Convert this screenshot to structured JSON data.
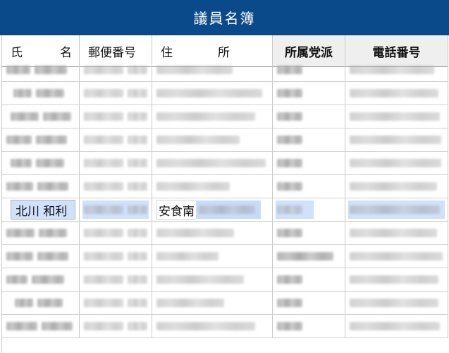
{
  "title": "議員名簿",
  "columns": {
    "name_a": "氏",
    "name_b": "名",
    "postal": "郵便番号",
    "addr_a": "住",
    "addr_b": "所",
    "party": "所属党派",
    "phone": "電話番号"
  },
  "selected_row": {
    "name": "北川 和利",
    "address_prefix": "安食南"
  },
  "colors": {
    "title_bar": "#0b4a8a",
    "highlight": "#cfe1fb",
    "header_shade": "#efefef"
  }
}
